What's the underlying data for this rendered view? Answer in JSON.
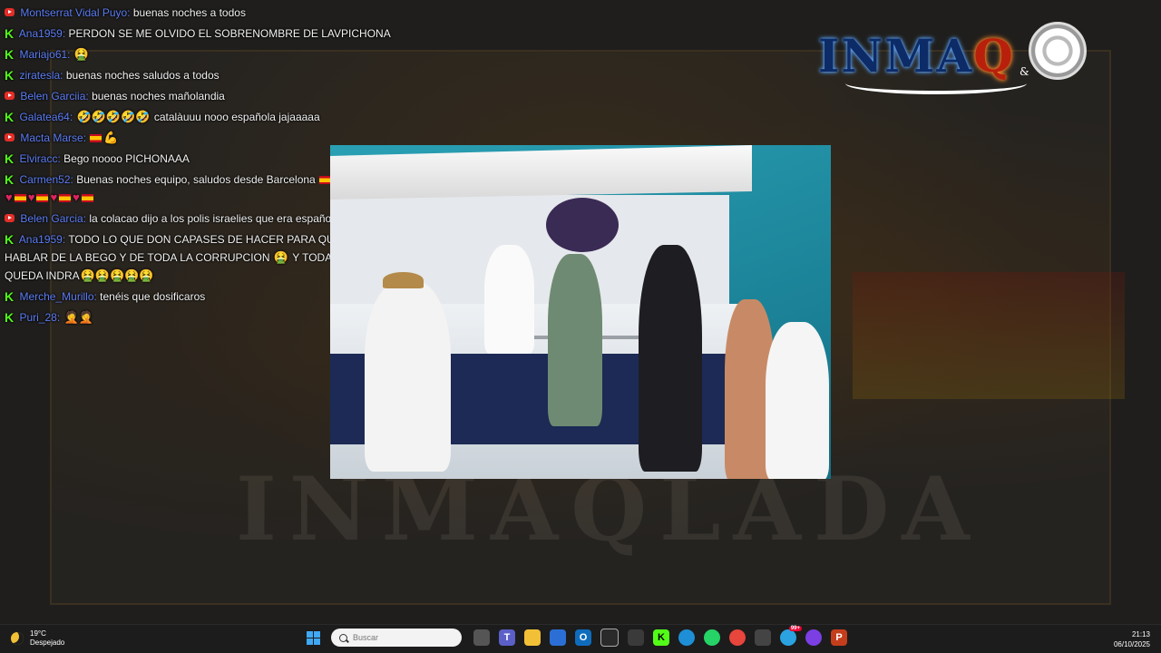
{
  "chat": {
    "messages": [
      {
        "source": "youtube",
        "user": "Montserrat Vidal Puyo:",
        "text": "buenas noches a todos"
      },
      {
        "source": "kick",
        "user": "Ana1959:",
        "text": "PERDON SE ME OLVIDO EL SOBRENOMBRE DE LAVPICHONA"
      },
      {
        "source": "kick",
        "user": "Mariajo61:",
        "text": "",
        "emoji": "🤮"
      },
      {
        "source": "kick",
        "user": "ziratesla:",
        "text": "buenas noches saludos a todos"
      },
      {
        "source": "youtube",
        "user": "Belen Garciia:",
        "text": "buenas noches mañolandia"
      },
      {
        "source": "kick",
        "user": "Galatea64:",
        "text": "catalàuuu nooo española jajaaaaa",
        "emoji": "🤣🤣🤣🤣🤣"
      },
      {
        "source": "youtube",
        "user": "Macta Marse:",
        "text": "",
        "emoji": "💪"
      },
      {
        "source": "kick",
        "user": "Elviracc:",
        "text": "Bego noooo PICHONAAA"
      },
      {
        "source": "kick",
        "user": "Carmen52:",
        "text": "Buenas noches equipo, saludos desde Barcelona"
      },
      {
        "source": "youtube",
        "user": "Belen Garcia:",
        "text": "la colacao dijo a los polis israelies que era española"
      },
      {
        "source": "kick",
        "user": "Ana1959:",
        "text": "TODO LO QUE DON CAPASES DE HACER PARA QUE SE DEJE DE HABLAR DE LA BEGO Y DE TODA LA CORRUPCION",
        "text2": "Y TODAVIA NOS QUEDA INDRA",
        "emoji": "🤮",
        "emoji2": "🤮🤮🤮🤮🤮"
      },
      {
        "source": "kick",
        "user": "Merche_Murillo:",
        "text": "tenéis que dosificaros"
      },
      {
        "source": "kick",
        "user": "Puri_28:",
        "text": "",
        "emoji": "🤦🤦"
      }
    ]
  },
  "logo": {
    "text_a": "INMA",
    "text_q": "Q",
    "amp": "&"
  },
  "background": {
    "wordmark": "INMAQLADA"
  },
  "taskbar": {
    "weather_temp": "19°C",
    "weather_desc": "Despejado",
    "search_placeholder": "Buscar",
    "time": "21:13",
    "date": "06/10/2025",
    "notification_badge": "99+"
  },
  "colors": {
    "username": "#5c7df5",
    "kick": "#53fc18",
    "youtube": "#e52d27"
  }
}
